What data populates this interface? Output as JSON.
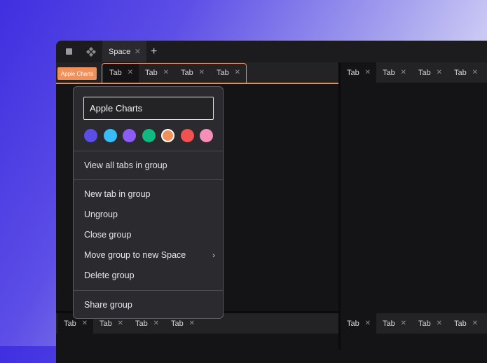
{
  "topbar": {
    "sidebar_icon": "sidebar-toggle-icon",
    "spaces_icon": "spaces-icon",
    "space_tab_label": "Space",
    "close_glyph": "✕",
    "new_space_glyph": "+"
  },
  "tab_group": {
    "name": "Apple Charts",
    "color": "#f0905a"
  },
  "panes": {
    "top_left": {
      "tabs": [
        {
          "label": "Tab"
        },
        {
          "label": "Tab"
        },
        {
          "label": "Tab"
        },
        {
          "label": "Tab"
        }
      ]
    },
    "top_right": {
      "tabs": [
        {
          "label": "Tab"
        },
        {
          "label": "Tab"
        },
        {
          "label": "Tab"
        },
        {
          "label": "Tab"
        }
      ]
    },
    "bottom_left": {
      "tabs": [
        {
          "label": "Tab"
        },
        {
          "label": "Tab"
        },
        {
          "label": "Tab"
        },
        {
          "label": "Tab"
        }
      ]
    },
    "bottom_right": {
      "tabs": [
        {
          "label": "Tab"
        },
        {
          "label": "Tab"
        },
        {
          "label": "Tab"
        },
        {
          "label": "Tab"
        }
      ]
    },
    "tab_close_glyph": "✕"
  },
  "context_menu": {
    "name_value": "Apple Charts",
    "colors": [
      {
        "name": "indigo",
        "hex": "#5b4ee6"
      },
      {
        "name": "sky",
        "hex": "#38bdf8"
      },
      {
        "name": "purple",
        "hex": "#8b5cf6"
      },
      {
        "name": "green",
        "hex": "#10b981"
      },
      {
        "name": "orange",
        "hex": "#f0905a",
        "selected": true
      },
      {
        "name": "red",
        "hex": "#f05252"
      },
      {
        "name": "pink",
        "hex": "#f490b8"
      }
    ],
    "view_all": "View all tabs in group",
    "new_tab": "New tab in group",
    "ungroup": "Ungroup",
    "close_group": "Close group",
    "move_group": "Move group to new Space",
    "move_group_chevron": "›",
    "delete_group": "Delete group",
    "share_group": "Share group"
  }
}
